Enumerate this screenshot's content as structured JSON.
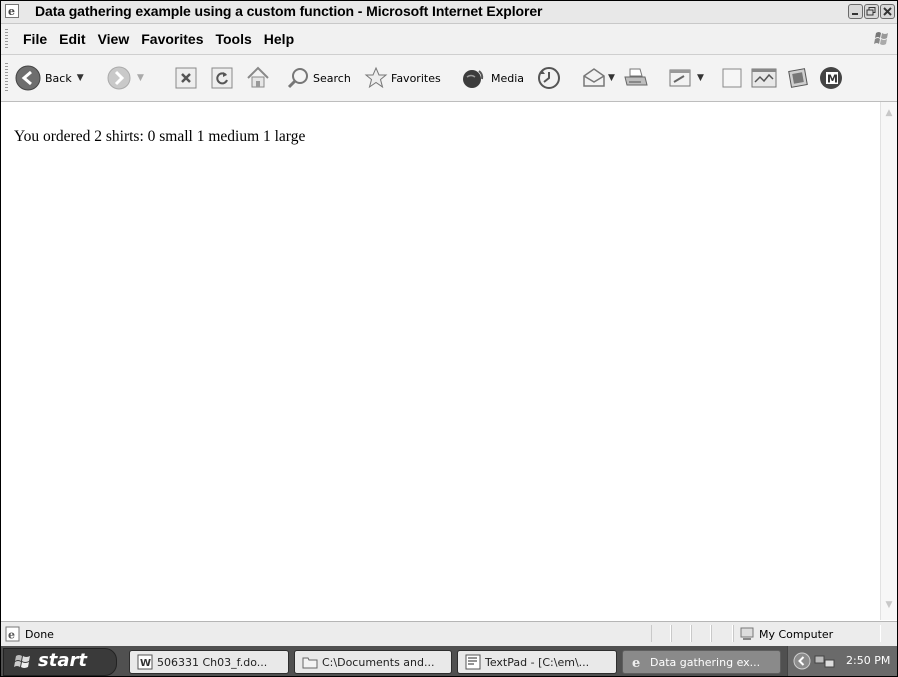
{
  "window": {
    "title": "Data gathering example using a custom function - Microsoft Internet Explorer"
  },
  "menubar": {
    "items": [
      "File",
      "Edit",
      "View",
      "Favorites",
      "Tools",
      "Help"
    ]
  },
  "toolbar": {
    "back_label": "Back",
    "search_label": "Search",
    "favorites_label": "Favorites",
    "media_label": "Media"
  },
  "content": {
    "message": "You ordered 2 shirts: 0 small 1 medium 1 large"
  },
  "statusbar": {
    "status_text": "Done",
    "zone_text": "My Computer"
  },
  "taskbar": {
    "start_label": "start",
    "tasks": [
      {
        "label": "506331 Ch03_f.do...",
        "icon": "word-document-icon"
      },
      {
        "label": "C:\\Documents and...",
        "icon": "folder-icon"
      },
      {
        "label": "TextPad - [C:\\em\\...",
        "icon": "textpad-icon"
      },
      {
        "label": "Data gathering ex...",
        "icon": "internet-explorer-icon"
      }
    ],
    "clock": "2:50 PM"
  }
}
